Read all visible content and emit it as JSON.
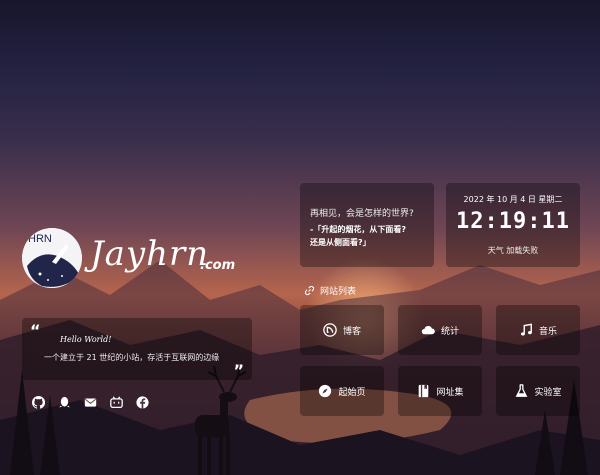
{
  "brand": {
    "name": "Jayhrn",
    "domain": ".com",
    "avatar_text": "HRN"
  },
  "hello": {
    "title": "Hello World!",
    "text": "一个建立于 21 世纪的小站，存活于互联网的边缘",
    "quote_open": "“",
    "quote_close": "”"
  },
  "socials": [
    {
      "icon": "github-icon"
    },
    {
      "icon": "qq-icon"
    },
    {
      "icon": "email-icon"
    },
    {
      "icon": "bilibili-icon"
    },
    {
      "icon": "facebook-icon"
    }
  ],
  "quote_card": {
    "line1": "再相见，会是怎样的世界?",
    "line2": "-「升起的烟花，从下面看?",
    "line3": "还是从侧面看?」"
  },
  "clock": {
    "date": "2022 年 10 月 4 日 星期二",
    "time": "12:19:11",
    "weather": "天气 加载失败"
  },
  "sites": {
    "heading": "网站列表",
    "items": [
      {
        "label": "博客",
        "icon": "blog-icon"
      },
      {
        "label": "统计",
        "icon": "cloud-icon"
      },
      {
        "label": "音乐",
        "icon": "music-icon"
      },
      {
        "label": "起始页",
        "icon": "compass-icon"
      },
      {
        "label": "网址集",
        "icon": "book-icon"
      },
      {
        "label": "实验室",
        "icon": "flask-icon"
      }
    ]
  },
  "colors": {
    "card_bg": "rgba(0,0,0,0.32)",
    "text": "#ffffff",
    "sky_top": "#17162b",
    "horizon": "#b5654d"
  }
}
